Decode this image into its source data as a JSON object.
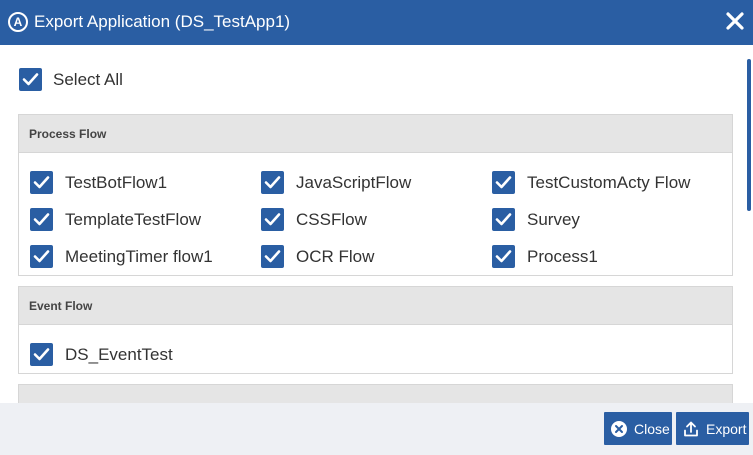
{
  "dialog": {
    "title": "Export Application (DS_TestApp1)",
    "logo_glyph": "A",
    "accent_color": "#2a5ea3"
  },
  "select_all": {
    "label": "Select All",
    "checked": true
  },
  "sections": [
    {
      "title": "Process Flow",
      "items": [
        {
          "label": "TestBotFlow1",
          "checked": true
        },
        {
          "label": "JavaScriptFlow",
          "checked": true
        },
        {
          "label": "TestCustomActy Flow",
          "checked": true
        },
        {
          "label": "TemplateTestFlow",
          "checked": true
        },
        {
          "label": "CSSFlow",
          "checked": true
        },
        {
          "label": "Survey",
          "checked": true
        },
        {
          "label": "MeetingTimer flow1",
          "checked": true
        },
        {
          "label": "OCR Flow",
          "checked": true
        },
        {
          "label": "Process1",
          "checked": true
        }
      ]
    },
    {
      "title": "Event Flow",
      "items": [
        {
          "label": "DS_EventTest",
          "checked": true
        }
      ]
    }
  ],
  "footer": {
    "close_label": "Close",
    "export_label": "Export"
  }
}
